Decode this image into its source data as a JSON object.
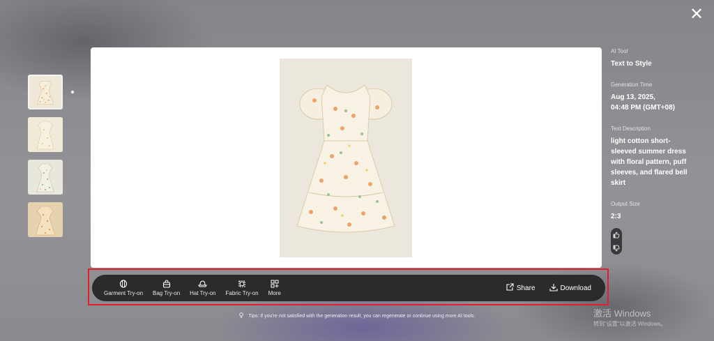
{
  "thumbnails": [
    {
      "name": "thumbnail-1",
      "active": true
    },
    {
      "name": "thumbnail-2",
      "active": false
    },
    {
      "name": "thumbnail-3",
      "active": false
    },
    {
      "name": "thumbnail-4",
      "active": false
    }
  ],
  "info": {
    "ai_tool_label": "AI Tool",
    "ai_tool_value": "Text to Style",
    "generation_time_label": "Generation Time",
    "generation_time_value_line1": "Aug 13, 2025,",
    "generation_time_value_line2": "04:48 PM (GMT+08)",
    "text_description_label": "Text Description",
    "text_description_value": "light cotton short-sleeved summer dress with floral pattern, puff sleeves, and flared bell skirt",
    "output_size_label": "Output Size",
    "output_size_value": "2:3"
  },
  "toolbar": {
    "tools": [
      {
        "label": "Garment Try-on",
        "icon": "garment-icon"
      },
      {
        "label": "Bag Try-on",
        "icon": "bag-icon"
      },
      {
        "label": "Hat Try-on",
        "icon": "hat-icon"
      },
      {
        "label": "Fabric Try-on",
        "icon": "fabric-icon"
      },
      {
        "label": "More",
        "icon": "grid-plus-icon"
      }
    ],
    "share_label": "Share",
    "download_label": "Download"
  },
  "tips": "Tips: If you're not satisfied with the generation result, you can regenerate or continue using more AI tools.",
  "watermark": {
    "line1": "激活 Windows",
    "line2": "转到\"设置\"以激活 Windows。"
  },
  "colors": {
    "highlight_border": "#e0202c",
    "toolbar_bg": "#2a2b2a"
  }
}
